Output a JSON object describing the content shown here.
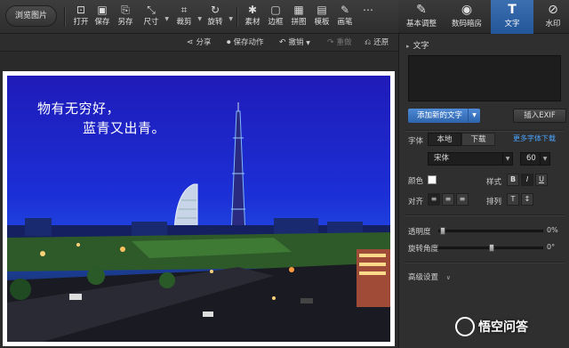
{
  "toolbar": {
    "browse_label": "浏览图片",
    "tools": [
      {
        "label": "打开",
        "icon": "open-icon",
        "glyph": "⊡"
      },
      {
        "label": "保存",
        "icon": "save-icon",
        "glyph": "▣"
      },
      {
        "label": "另存",
        "icon": "save-as-icon",
        "glyph": "⎘"
      },
      {
        "label": "尺寸",
        "icon": "resize-icon",
        "glyph": "⤡"
      },
      {
        "label": "裁剪",
        "icon": "crop-icon",
        "glyph": "⌗"
      },
      {
        "label": "旋转",
        "icon": "rotate-icon",
        "glyph": "↻"
      },
      {
        "label": "素材",
        "icon": "material-icon",
        "glyph": "✱"
      },
      {
        "label": "边框",
        "icon": "border-icon",
        "glyph": "▢"
      },
      {
        "label": "拼图",
        "icon": "collage-icon",
        "glyph": "▦"
      },
      {
        "label": "模板",
        "icon": "template-icon",
        "glyph": "▤"
      },
      {
        "label": "画笔",
        "icon": "brush-icon",
        "glyph": "✎"
      },
      {
        "label": "",
        "icon": "more-icon",
        "glyph": "⋯"
      }
    ]
  },
  "right_tabs": [
    {
      "label": "基本调整",
      "icon": "adjust-icon",
      "glyph": "✎"
    },
    {
      "label": "数码暗房",
      "icon": "darkroom-icon",
      "glyph": "◉"
    },
    {
      "label": "文字",
      "icon": "text-icon",
      "glyph": "T"
    },
    {
      "label": "水印",
      "icon": "watermark-icon",
      "glyph": "⊘"
    }
  ],
  "actionbar": {
    "share": "分享",
    "save_action": "保存动作",
    "undo": "撤销",
    "redo": "重做",
    "restore": "还原"
  },
  "photo": {
    "line1": "物有无穷好，",
    "line2": "蓝青又出青。"
  },
  "panel": {
    "header": "文字",
    "add_text_button": "添加新的文字",
    "insert_exif_button": "插入EXIF",
    "font_label": "字体",
    "font_local": "本地",
    "font_download": "下载",
    "more_fonts_link": "更多字体下载",
    "font_name": "宋体",
    "font_size": "60",
    "color_label": "颜色",
    "style_label": "样式",
    "style_bold": "B",
    "style_italic": "I",
    "style_underline": "U",
    "align_label": "对齐",
    "arrange_label": "排列",
    "opacity_label": "透明度",
    "opacity_value": "0%",
    "rotation_label": "旋转角度",
    "rotation_value": "0°",
    "advanced_label": "高级设置"
  },
  "watermark_text": "悟空问答",
  "colors": {
    "accent_blue": "#2e64ad",
    "link_blue": "#4aa3ff",
    "panel_bg": "#2f2f2f"
  }
}
